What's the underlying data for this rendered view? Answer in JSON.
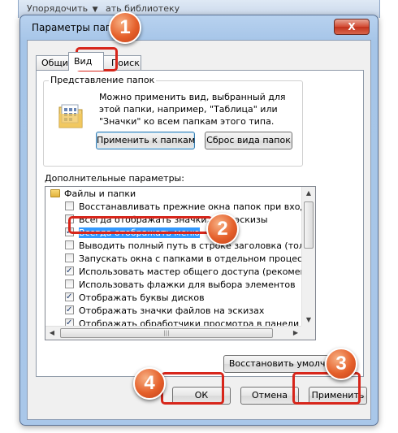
{
  "background_window": {
    "text": "Упорядочить",
    "text2": "ать библиотеку"
  },
  "window": {
    "title": "Параметры папок",
    "close": "X"
  },
  "tabs": [
    {
      "label": "Общие"
    },
    {
      "label": "Вид"
    },
    {
      "label": "Поиск"
    }
  ],
  "folder_view": {
    "group_title": "Представление папок",
    "description": "Можно применить вид, выбранный для этой папки, например, \"Таблица\" или \"Значки\" ко всем папкам этого типа.",
    "apply_button": "Применить к папкам",
    "reset_button": "Сброс вида папок"
  },
  "advanced": {
    "label": "Дополнительные параметры:",
    "folder_node": "Файлы и папки",
    "items": [
      {
        "label": "Восстанавливать прежние окна папок при входе в си",
        "checked": false
      },
      {
        "label": "Всегда отображать значки, а не эскизы",
        "checked": false
      },
      {
        "label": "Всегда отображать меню",
        "checked": true
      },
      {
        "label": "Выводить полный путь в строке заголовка (только д",
        "checked": false
      },
      {
        "label": "Запускать окна с папками в отдельном процессе",
        "checked": false
      },
      {
        "label": "Использовать мастер общего доступа (рекомендует",
        "checked": true
      },
      {
        "label": "Использовать флажки для выбора элементов",
        "checked": false
      },
      {
        "label": "Отображать буквы дисков",
        "checked": true
      },
      {
        "label": "Отображать значки файлов на эскизах",
        "checked": true
      },
      {
        "label": "Отображать обработчики просмотра в панели просм",
        "checked": true
      }
    ],
    "restore_defaults": "Восстановить умолчания"
  },
  "buttons": {
    "ok": "ОК",
    "cancel": "Отмена",
    "apply": "Применить"
  },
  "markers": [
    "1",
    "2",
    "3",
    "4"
  ],
  "colors": {
    "marker": "#e5602b",
    "frame": "#d7261b",
    "selection": "#3399ff"
  }
}
